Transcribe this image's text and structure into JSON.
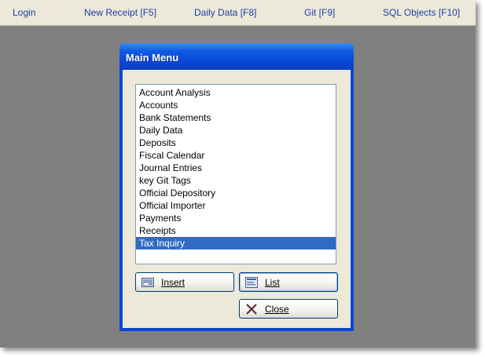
{
  "menubar": {
    "items": [
      {
        "label": "Login"
      },
      {
        "label": "New Receipt [F5]"
      },
      {
        "label": "Daily Data [F8]"
      },
      {
        "label": "Git [F9]"
      },
      {
        "label": "SQL Objects [F10]"
      }
    ]
  },
  "dialog": {
    "title": "Main Menu",
    "list": {
      "items": [
        "Account Analysis",
        "Accounts",
        "Bank Statements",
        "Daily Data",
        "Deposits",
        "Fiscal Calendar",
        "Journal Entries",
        "key Git Tags",
        "Official Depository",
        "Official Importer",
        "Payments",
        "Receipts",
        "Tax Inquiry"
      ],
      "selected": "Tax Inquiry"
    },
    "buttons": {
      "insert": {
        "label": "Insert",
        "icon": "insert-icon"
      },
      "list": {
        "label": "List",
        "icon": "list-icon"
      },
      "close": {
        "label": "Close",
        "icon": "close-x-icon"
      }
    }
  },
  "colors": {
    "title_bar": "#0a48d8",
    "selection": "#316ac5",
    "menu_text": "#1c3fa8",
    "background": "#808080"
  }
}
